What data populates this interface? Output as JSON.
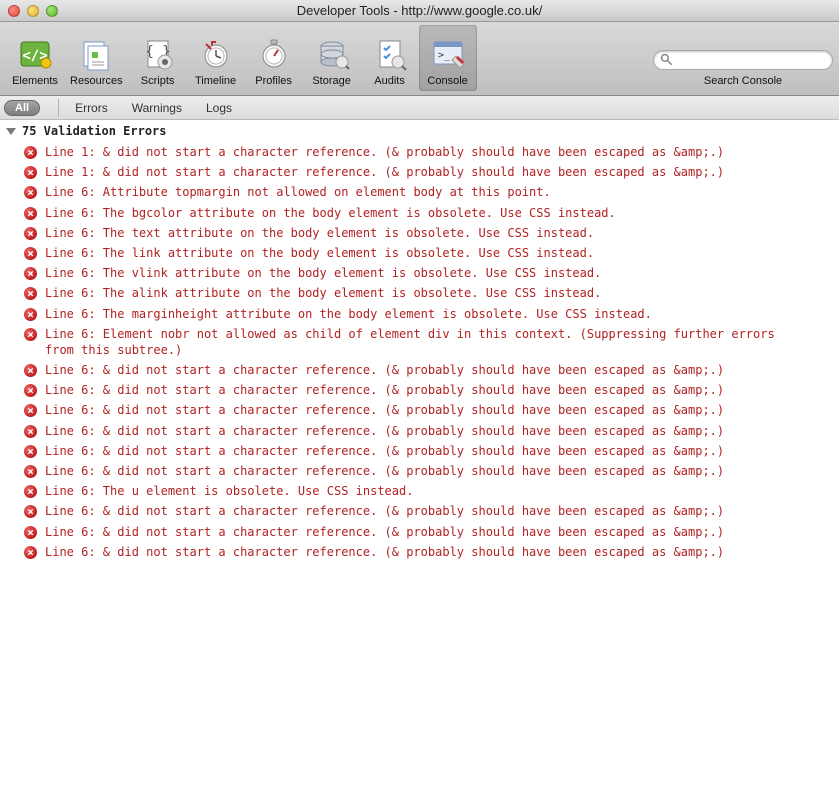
{
  "window": {
    "title": "Developer Tools - http://www.google.co.uk/"
  },
  "toolbar": {
    "items": [
      {
        "id": "elements",
        "label": "Elements"
      },
      {
        "id": "resources",
        "label": "Resources"
      },
      {
        "id": "scripts",
        "label": "Scripts"
      },
      {
        "id": "timeline",
        "label": "Timeline"
      },
      {
        "id": "profiles",
        "label": "Profiles"
      },
      {
        "id": "storage",
        "label": "Storage"
      },
      {
        "id": "audits",
        "label": "Audits"
      },
      {
        "id": "console",
        "label": "Console"
      }
    ],
    "selected": "console"
  },
  "search": {
    "placeholder": "",
    "label": "Search Console"
  },
  "filters": {
    "all_label": "All",
    "items": [
      "Errors",
      "Warnings",
      "Logs"
    ]
  },
  "console_group": {
    "title": "75 Validation Errors"
  },
  "messages": [
    "Line 1: & did not start a character reference. (& probably should have been escaped as &amp;.)",
    "Line 1: & did not start a character reference. (& probably should have been escaped as &amp;.)",
    "Line 6: Attribute topmargin not allowed on element body at this point.",
    "Line 6: The bgcolor attribute on the body element is obsolete. Use CSS instead.",
    "Line 6: The text attribute on the body element is obsolete. Use CSS instead.",
    "Line 6: The link attribute on the body element is obsolete. Use CSS instead.",
    "Line 6: The vlink attribute on the body element is obsolete. Use CSS instead.",
    "Line 6: The alink attribute on the body element is obsolete. Use CSS instead.",
    "Line 6: The marginheight attribute on the body element is obsolete. Use CSS instead.",
    "Line 6: Element nobr not allowed as child of element div in this context. (Suppressing further errors from this subtree.)",
    "Line 6: & did not start a character reference. (& probably should have been escaped as &amp;.)",
    "Line 6: & did not start a character reference. (& probably should have been escaped as &amp;.)",
    "Line 6: & did not start a character reference. (& probably should have been escaped as &amp;.)",
    "Line 6: & did not start a character reference. (& probably should have been escaped as &amp;.)",
    "Line 6: & did not start a character reference. (& probably should have been escaped as &amp;.)",
    "Line 6: & did not start a character reference. (& probably should have been escaped as &amp;.)",
    "Line 6: The u element is obsolete. Use CSS instead.",
    "Line 6: & did not start a character reference. (& probably should have been escaped as &amp;.)",
    "Line 6: & did not start a character reference. (& probably should have been escaped as &amp;.)",
    "Line 6: & did not start a character reference. (& probably should have been escaped as &amp;.)"
  ]
}
